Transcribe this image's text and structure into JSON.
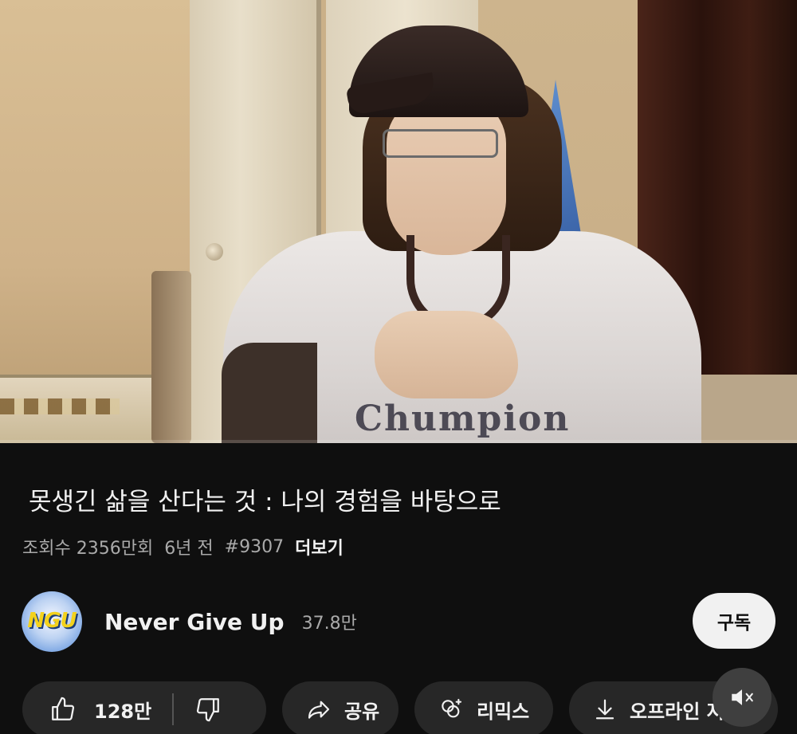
{
  "video": {
    "shirt_logo_text": "Chumpion"
  },
  "info": {
    "title": "못생긴 삶을 산다는 것 : 나의 경험을 바탕으로",
    "views": "조회수 2356만회",
    "age": "6년 전",
    "hashtag": "#9307",
    "more_label": "더보기"
  },
  "channel": {
    "avatar_text": "NGU",
    "name": "Never Give Up",
    "subscribers": "37.8만",
    "subscribe_label": "구독"
  },
  "actions": {
    "like_count": "128만",
    "share_label": "공유",
    "remix_label": "리믹스",
    "offline_label": "오프라인 저"
  },
  "icons": {
    "like": "thumbs-up-icon",
    "dislike": "thumbs-down-icon",
    "share": "share-arrow-icon",
    "remix": "remix-icon",
    "download": "download-icon",
    "mute": "muted-speaker-icon"
  },
  "colors": {
    "background": "#0f0f0f",
    "pill_background": "#272727",
    "subscribe_background": "#f1f1f1",
    "secondary_text": "#aaaaaa"
  }
}
